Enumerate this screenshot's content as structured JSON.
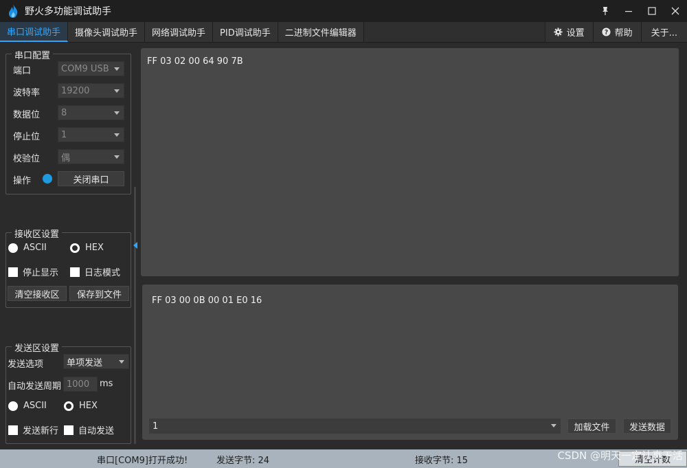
{
  "window": {
    "title": "野火多功能调试助手",
    "pin_icon": "pin-icon",
    "minimize_icon": "minimize-icon",
    "maximize_icon": "maximize-icon",
    "close_icon": "close-icon"
  },
  "tabs": [
    {
      "label": "串口调试助手",
      "active": true
    },
    {
      "label": "摄像头调试助手",
      "active": false
    },
    {
      "label": "网络调试助手",
      "active": false
    },
    {
      "label": "PID调试助手",
      "active": false
    },
    {
      "label": "二进制文件编辑器",
      "active": false
    }
  ],
  "toolbar": {
    "settings_label": "设置",
    "help_label": "帮助",
    "about_label": "关于..."
  },
  "serial_config": {
    "title": "串口配置",
    "port_label": "端口",
    "port_value": "COM9 USB",
    "baud_label": "波特率",
    "baud_value": "19200",
    "databits_label": "数据位",
    "databits_value": "8",
    "stopbits_label": "停止位",
    "stopbits_value": "1",
    "parity_label": "校验位",
    "parity_value": "偶",
    "operation_label": "操作",
    "close_port_label": "关闭串口"
  },
  "receive_settings": {
    "title": "接收区设置",
    "ascii_label": "ASCII",
    "hex_label": "HEX",
    "stop_display_label": "停止显示",
    "log_mode_label": "日志模式",
    "clear_label": "清空接收区",
    "save_label": "保存到文件"
  },
  "send_settings": {
    "title": "发送区设置",
    "send_option_label": "发送选项",
    "send_option_value": "单项发送",
    "auto_period_label": "自动发送周期",
    "auto_period_value": "1000",
    "period_unit": "ms",
    "ascii_label": "ASCII",
    "hex_label": "HEX",
    "newline_label": "发送新行",
    "auto_send_label": "自动发送"
  },
  "receive_area": {
    "text": "FF 03 02 00 64 90 7B"
  },
  "send_area": {
    "text": "FF 03 00 0B 00 01 E0 16",
    "history_value": "1",
    "load_file_label": "加载文件",
    "send_data_label": "发送数据"
  },
  "status": {
    "message": "串口[COM9]打开成功!",
    "sent_bytes": "发送字节: 24",
    "received_bytes": "接收字节: 15",
    "clear_count_label": "清空计数"
  },
  "watermark": "CSDN @明天一定认真干活",
  "colors": {
    "accent": "#2ea8ff",
    "led": "#1e9be0",
    "statusbar": "#a8b3bd"
  }
}
